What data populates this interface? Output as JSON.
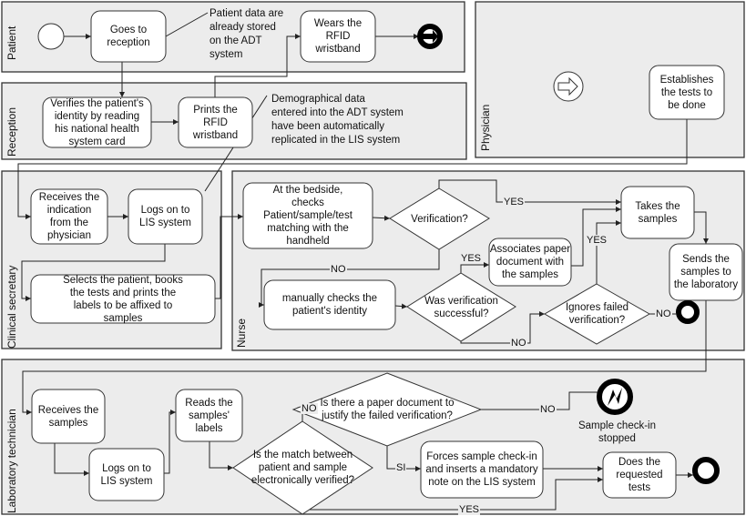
{
  "colors": {
    "lane_fill": "#ececec",
    "node_fill": "#ffffff",
    "stroke": "#333333",
    "event_fill": "#000000"
  },
  "lanes": {
    "patient": "Patient",
    "reception": "Reception",
    "physician": "Physician",
    "clinical_secretary": "Clinical secretary",
    "nurse": "Nurse",
    "lab_technician": "Laboratory technician"
  },
  "tasks": {
    "goes_to_reception": "Goes to\nreception",
    "wears_wristband": "Wears the\nRFID\nwristband",
    "verifies_identity": "Verifies the patient's\nidentity by reading\nhis national health\nsystem card",
    "prints_wristband": "Prints the\nRFID\nwristband",
    "establishes_tests": "Establishes\nthe tests to\nbe done",
    "receives_indication": "Receives the\nindication\nfrom the\nphysician",
    "logs_on_lis_secretary": "Logs on to\nLIS system",
    "selects_patient": "Selects the patient, books\nthe tests and prints the\nlabels to be affixed to\nsamples",
    "bedside_check": "At the bedside,\nchecks\nPatient/sample/test\nmatching with the\nhandheld",
    "takes_samples": "Takes the\nsamples",
    "sends_samples": "Sends the\nsamples to\nthe laboratory",
    "associates_paper": "Associates paper\ndocument with\nthe samples",
    "manually_checks": "manually checks the\npatient's identity",
    "receives_samples": "Receives the\nsamples",
    "logs_on_lis_lab": "Logs on to\nLIS system",
    "reads_labels": "Reads the\nsamples'\nlabels",
    "forces_checkin": "Forces sample check-in\nand inserts a mandatory\nnote on the LIS system",
    "does_tests": "Does the\nrequested\ntests"
  },
  "gateways": {
    "verification": "Verification?",
    "was_successful": "Was verification\nsuccessful?",
    "ignores_failed": "Ignores failed\nverification?",
    "match_verified": "Is the match between\npatient and sample\nelectronically verified?",
    "paper_document": "Is there a paper document to\njustify the failed verification?"
  },
  "annotations": {
    "adt_stored": "Patient data are\nalready stored\non the ADT\nsystem",
    "demographic": "Demographical data\nentered into the ADT system\nhave been automatically\nreplicated in the LIS system"
  },
  "events": {
    "error_end_label": "Sample check-in\nstopped",
    "patient_end_icon": "message-end-icon",
    "physician_start_icon": "message-start-icon",
    "error_end_icon": "error-end-icon"
  },
  "flow_labels": {
    "yes1": "YES",
    "no1": "NO",
    "yes2": "YES",
    "no2": "NO",
    "yes3": "YES",
    "no3": "NO",
    "no4": "NO",
    "no5": "NO",
    "si": "SI",
    "yes4": "YES"
  }
}
